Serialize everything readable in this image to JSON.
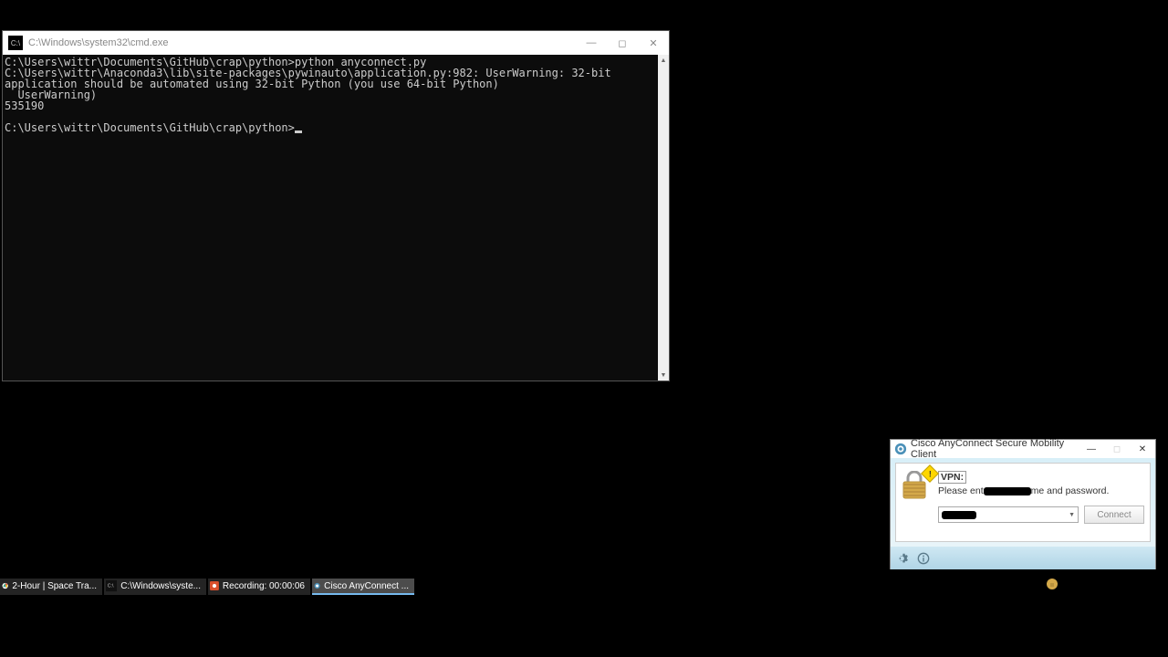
{
  "cmd": {
    "title": "C:\\Windows\\system32\\cmd.exe",
    "lines": [
      "C:\\Users\\wittr\\Documents\\GitHub\\crap\\python>python anyconnect.py",
      "C:\\Users\\wittr\\Anaconda3\\lib\\site-packages\\pywinauto\\application.py:982: UserWarning: 32-bit application should be automated using 32-bit Python (you use 64-bit Python)",
      "  UserWarning)",
      "535190",
      "",
      "C:\\Users\\wittr\\Documents\\GitHub\\crap\\python>"
    ]
  },
  "cisco": {
    "title": "Cisco AnyConnect Secure Mobility Client",
    "vpn_label": "VPN:",
    "msg_prefix": "Please ent",
    "msg_suffix": "me and password.",
    "connect_label": "Connect"
  },
  "taskbar": {
    "items": [
      {
        "label": "2-Hour | Space Tra...",
        "color": "#1a73e8"
      },
      {
        "label": "C:\\Windows\\syste...",
        "color": "#222"
      },
      {
        "label": "Recording: 00:00:06",
        "color": "#d94f2b"
      },
      {
        "label": "Cisco AnyConnect ...",
        "color": "#3a7aa0"
      }
    ]
  }
}
